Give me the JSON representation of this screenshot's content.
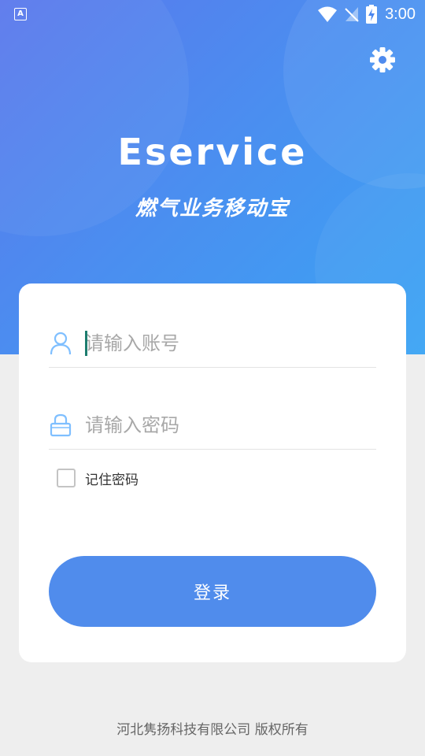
{
  "status_bar": {
    "app_icon_letter": "A",
    "time": "3:00"
  },
  "header": {
    "brand_title": "Eservice",
    "brand_subtitle": "燃气业务移动宝"
  },
  "login_form": {
    "account_placeholder": "请输入账号",
    "account_value": "",
    "password_placeholder": "请输入密码",
    "password_value": "",
    "remember_label": "记住密码",
    "remember_checked": false,
    "login_button_label": "登录"
  },
  "footer": {
    "copyright": "河北隽扬科技有限公司 版权所有"
  },
  "colors": {
    "gradient_start": "#5a78ec",
    "gradient_end": "#3aa4f4",
    "button": "#508cec",
    "icon_blue": "#7fbfff"
  },
  "icons": {
    "settings": "gear-icon",
    "account": "user-icon",
    "password": "lock-icon"
  }
}
